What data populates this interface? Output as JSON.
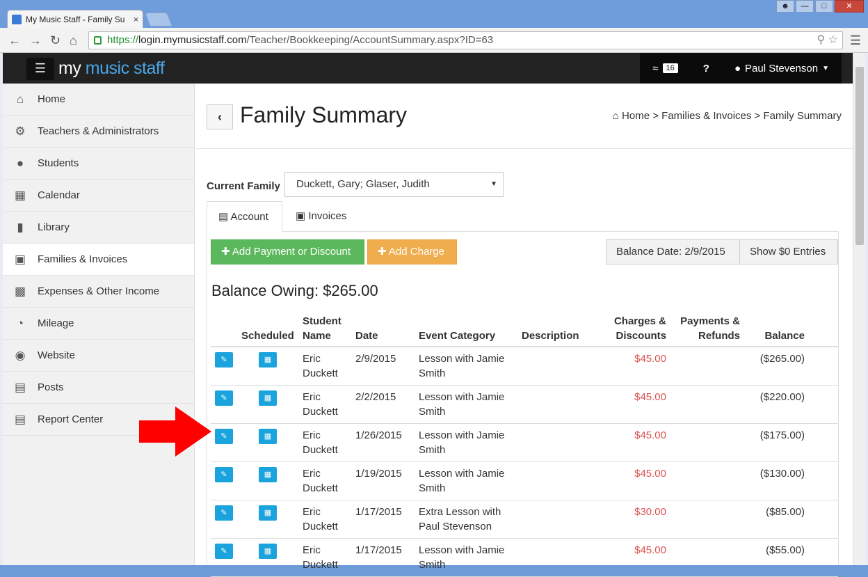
{
  "browser": {
    "tab_title": "My Music Staff - Family Su",
    "tab_close": "×",
    "url_https": "https://",
    "url_host": "login.mymusicstaff.com",
    "url_path": "/Teacher/Bookkeeping/AccountSummary.aspx?ID=63"
  },
  "appbar": {
    "logo_prefix": "my ",
    "logo_brand": "music staff",
    "feed_count": "16",
    "user_name": "Paul Stevenson"
  },
  "sidebar": {
    "items": [
      {
        "label": "Home",
        "icon": "home-icon"
      },
      {
        "label": "Teachers & Administrators",
        "icon": "gear-icon"
      },
      {
        "label": "Students",
        "icon": "users-icon"
      },
      {
        "label": "Calendar",
        "icon": "calendar-icon"
      },
      {
        "label": "Library",
        "icon": "book-icon"
      },
      {
        "label": "Families & Invoices",
        "icon": "money-icon"
      },
      {
        "label": "Expenses & Other Income",
        "icon": "bar-chart-icon"
      },
      {
        "label": "Mileage",
        "icon": "dashboard-icon"
      },
      {
        "label": "Website",
        "icon": "globe-icon"
      },
      {
        "label": "Posts",
        "icon": "newspaper-icon"
      },
      {
        "label": "Report Center",
        "icon": "file-icon"
      }
    ]
  },
  "header": {
    "title": "Family Summary",
    "breadcrumb": [
      "Home",
      "Families & Invoices",
      "Family Summary"
    ]
  },
  "family": {
    "label": "Current Family",
    "selected": "Duckett, Gary; Glaser, Judith"
  },
  "tabs": {
    "account": "Account",
    "invoices": "Invoices"
  },
  "actions": {
    "add_payment": "Add Payment or Discount",
    "add_charge": "Add Charge",
    "balance_date": "Balance Date: 2/9/2015",
    "show_zero": "Show $0 Entries"
  },
  "balance": {
    "label": "Balance Owing: $265.00"
  },
  "table": {
    "headers": {
      "scheduled": "Scheduled",
      "student": "Student Name",
      "date": "Date",
      "category": "Event Category",
      "description": "Description",
      "charges": "Charges & Discounts",
      "payments": "Payments & Refunds",
      "balance": "Balance"
    },
    "rows": [
      {
        "student": "Eric Duckett",
        "date": "2/9/2015",
        "category": "Lesson with Jamie Smith",
        "charge": "$45.00",
        "balance": "($265.00)"
      },
      {
        "student": "Eric Duckett",
        "date": "2/2/2015",
        "category": "Lesson with Jamie Smith",
        "charge": "$45.00",
        "balance": "($220.00)"
      },
      {
        "student": "Eric Duckett",
        "date": "1/26/2015",
        "category": "Lesson with Jamie Smith",
        "charge": "$45.00",
        "balance": "($175.00)"
      },
      {
        "student": "Eric Duckett",
        "date": "1/19/2015",
        "category": "Lesson with Jamie Smith",
        "charge": "$45.00",
        "balance": "($130.00)"
      },
      {
        "student": "Eric Duckett",
        "date": "1/17/2015",
        "category": "Extra Lesson with Paul Stevenson",
        "charge": "$30.00",
        "balance": "($85.00)"
      },
      {
        "student": "Eric Duckett",
        "date": "1/17/2015",
        "category": "Lesson with Jamie Smith",
        "charge": "$45.00",
        "balance": "($55.00)"
      }
    ]
  },
  "colors": {
    "green": "#5cb85c",
    "orange": "#f0ad4e",
    "icon_blue": "#1aa3dc",
    "charge_red": "#d9534f",
    "arrow_red": "#ff0000"
  }
}
